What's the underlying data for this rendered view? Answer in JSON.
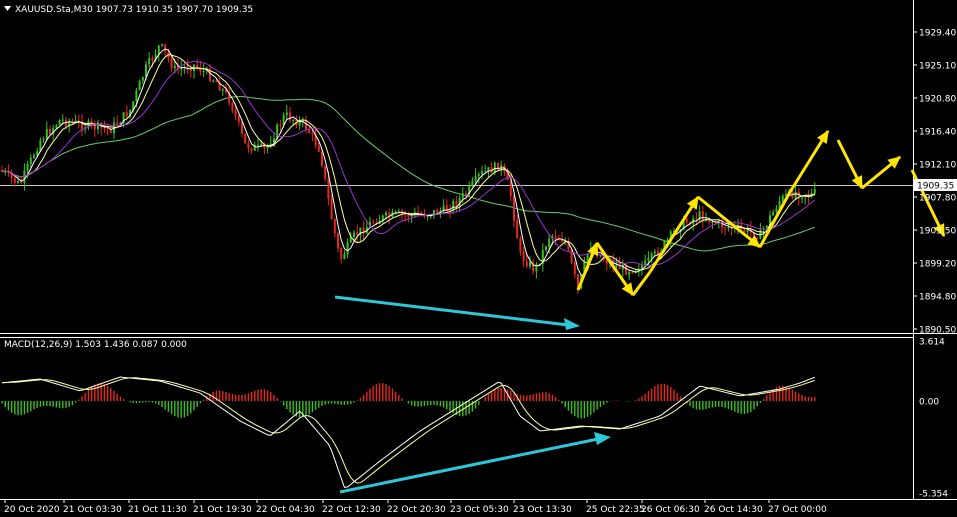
{
  "header": {
    "symbol_line": "XAUUSD.Sta,M30  1907.73 1910.35 1907.70 1909.35",
    "triangle_icon": "dropdown-triangle-icon"
  },
  "price_axis": {
    "ticks": [
      "1929.40",
      "1925.10",
      "1920.80",
      "1916.40",
      "1912.10",
      "1907.80",
      "1903.50",
      "1899.20",
      "1894.80",
      "1890.50"
    ],
    "current_price": "1909.35",
    "current_price_value": 1909.35
  },
  "macd": {
    "label": "MACD(12,26,9) 1.503 1.436 0.087 0.000",
    "axis_ticks": [
      "3.614",
      "0.00",
      "-5.354"
    ],
    "zero_value": 0.0
  },
  "time_axis": {
    "ticks": [
      "20 Oct 2020",
      "21 Oct 03:30",
      "21 Oct 11:30",
      "21 Oct 19:30",
      "22 Oct 04:30",
      "22 Oct 12:30",
      "22 Oct 20:30",
      "23 Oct 05:30",
      "23 Oct 13:30",
      "25 Oct 22:35",
      "26 Oct 06:30",
      "26 Oct 14:30",
      "27 Oct 00:00"
    ]
  },
  "colors": {
    "background": "#000000",
    "axis": "#ffffff",
    "bull_candle": "#39c21a",
    "bear_candle": "#e8291c",
    "ma_fast": "#ffffff",
    "ma_mid": "#ffff99",
    "ma_slow": "#9933cc",
    "ma_long": "#66cc66",
    "macd_hist_pos": "#e8291c",
    "macd_hist_neg": "#39c21a",
    "annotation_yellow": "#ffe500",
    "annotation_cyan": "#2cc8d8"
  },
  "annotations": {
    "price_divergence": "cyan-arrow",
    "macd_divergence": "cyan-arrow",
    "forecast_path": "yellow-zigzag-arrows"
  }
}
